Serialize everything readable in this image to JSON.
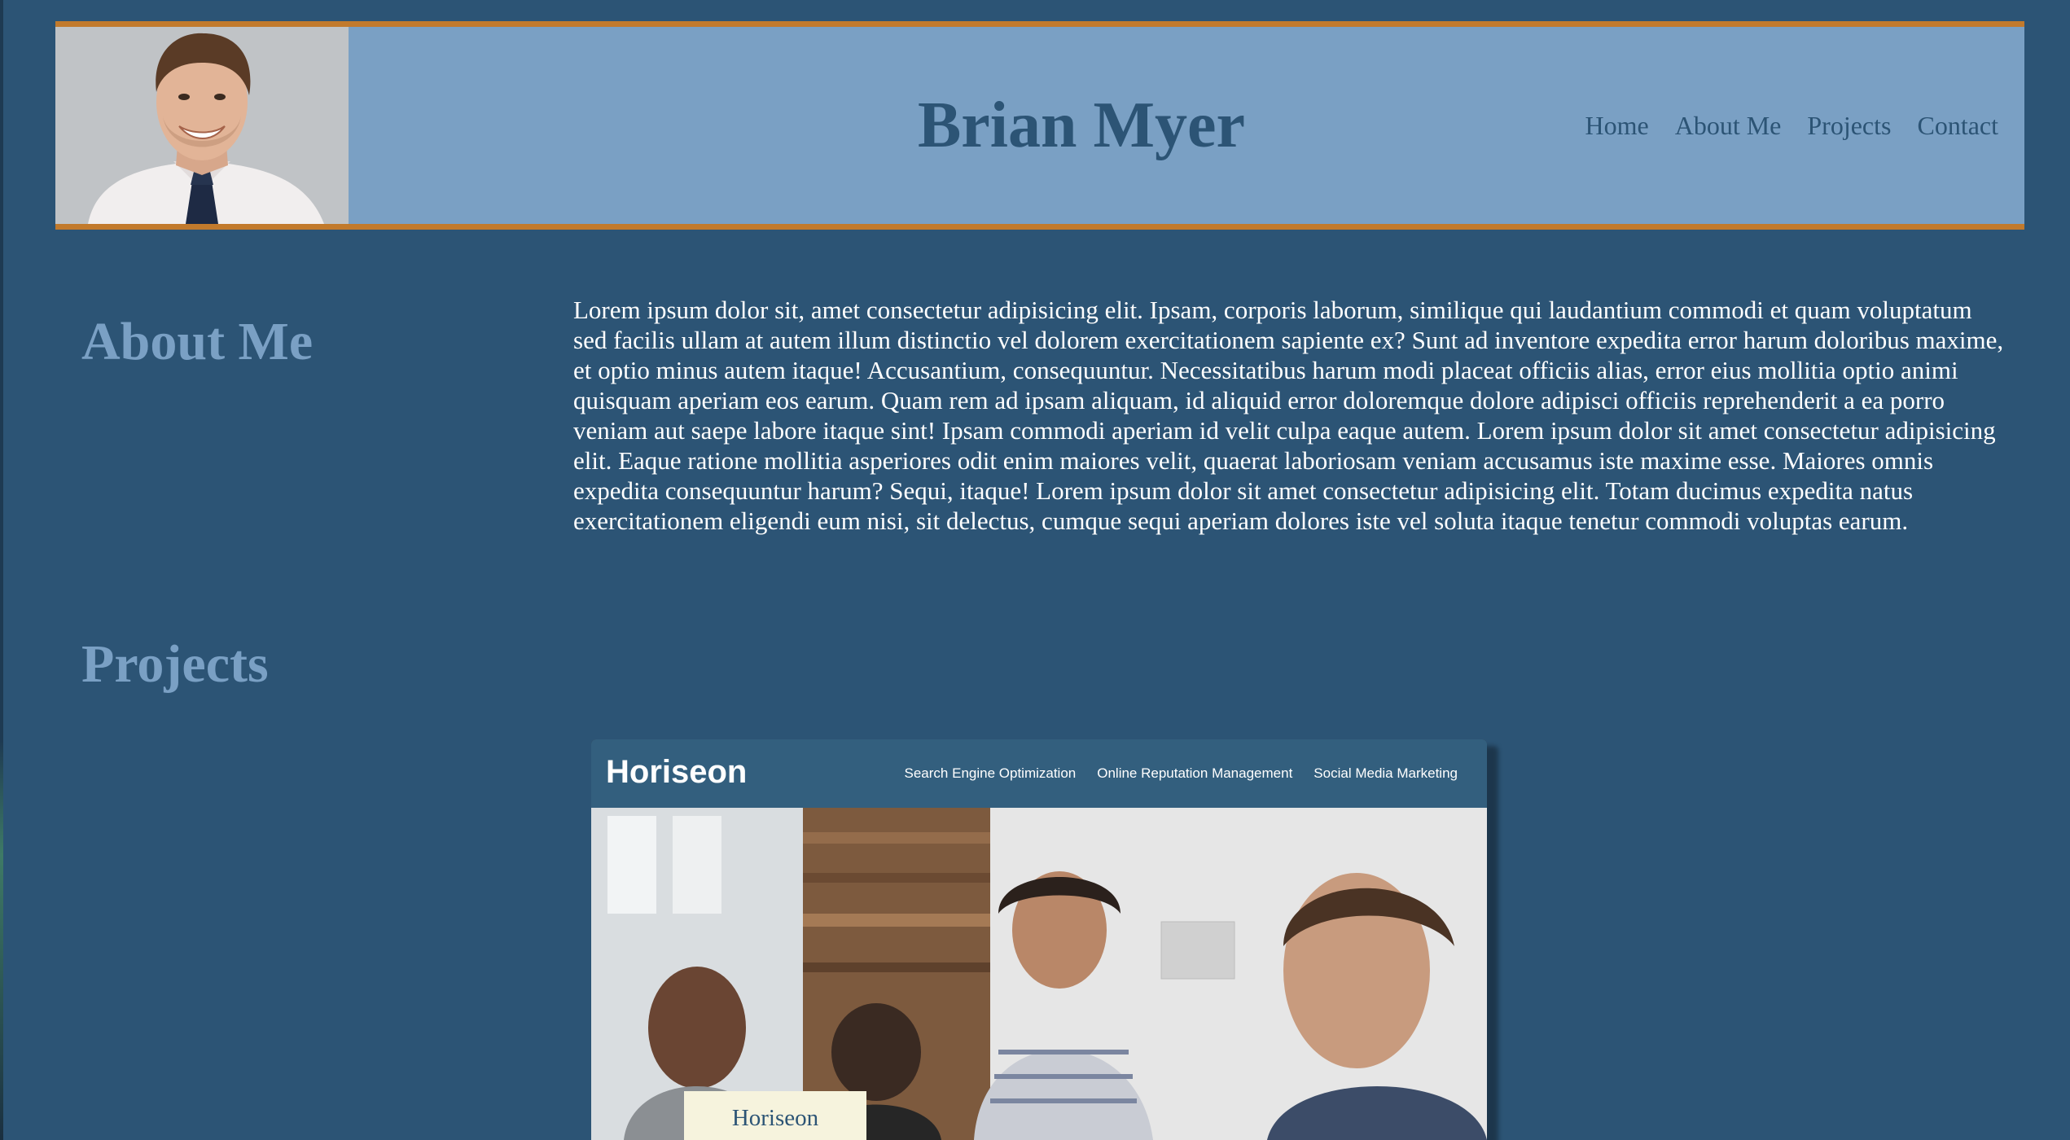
{
  "header": {
    "name": "Brian Myer",
    "nav": [
      "Home",
      "About Me",
      "Projects",
      "Contact"
    ]
  },
  "about": {
    "heading": "About Me",
    "text": "Lorem ipsum dolor sit, amet consectetur adipisicing elit. Ipsam, corporis laborum, similique qui laudantium commodi et quam voluptatum sed facilis ullam at autem illum distinctio vel dolorem exercitationem sapiente ex? Sunt ad inventore expedita error harum doloribus maxime, et optio minus autem itaque! Accusantium, consequuntur. Necessitatibus harum modi placeat officiis alias, error eius mollitia optio animi quisquam aperiam eos earum. Quam rem ad ipsam aliquam, id aliquid error doloremque dolore adipisci officiis reprehenderit a ea porro veniam aut saepe labore itaque sint! Ipsam commodi aperiam id velit culpa eaque autem. Lorem ipsum dolor sit amet consectetur adipisicing elit. Eaque ratione mollitia asperiores odit enim maiores velit, quaerat laboriosam veniam accusamus iste maxime esse. Maiores omnis expedita consequuntur harum? Sequi, itaque! Lorem ipsum dolor sit amet consectetur adipisicing elit. Totam ducimus expedita natus exercitationem eligendi eum nisi, sit delectus, cumque sequi aperiam dolores iste vel soluta itaque tenetur commodi voluptas earum."
  },
  "projects": {
    "heading": "Projects",
    "card": {
      "logo": "Horiseon",
      "links": [
        "Search Engine Optimization",
        "Online Reputation Management",
        "Social Media Marketing"
      ],
      "caption": "Horiseon"
    }
  },
  "colors": {
    "page_background": "#2c5475",
    "header_background": "#7aa0c4",
    "header_border": "#c27a2c",
    "heading_color": "#7aa0c4",
    "body_text": "#ffffff"
  }
}
